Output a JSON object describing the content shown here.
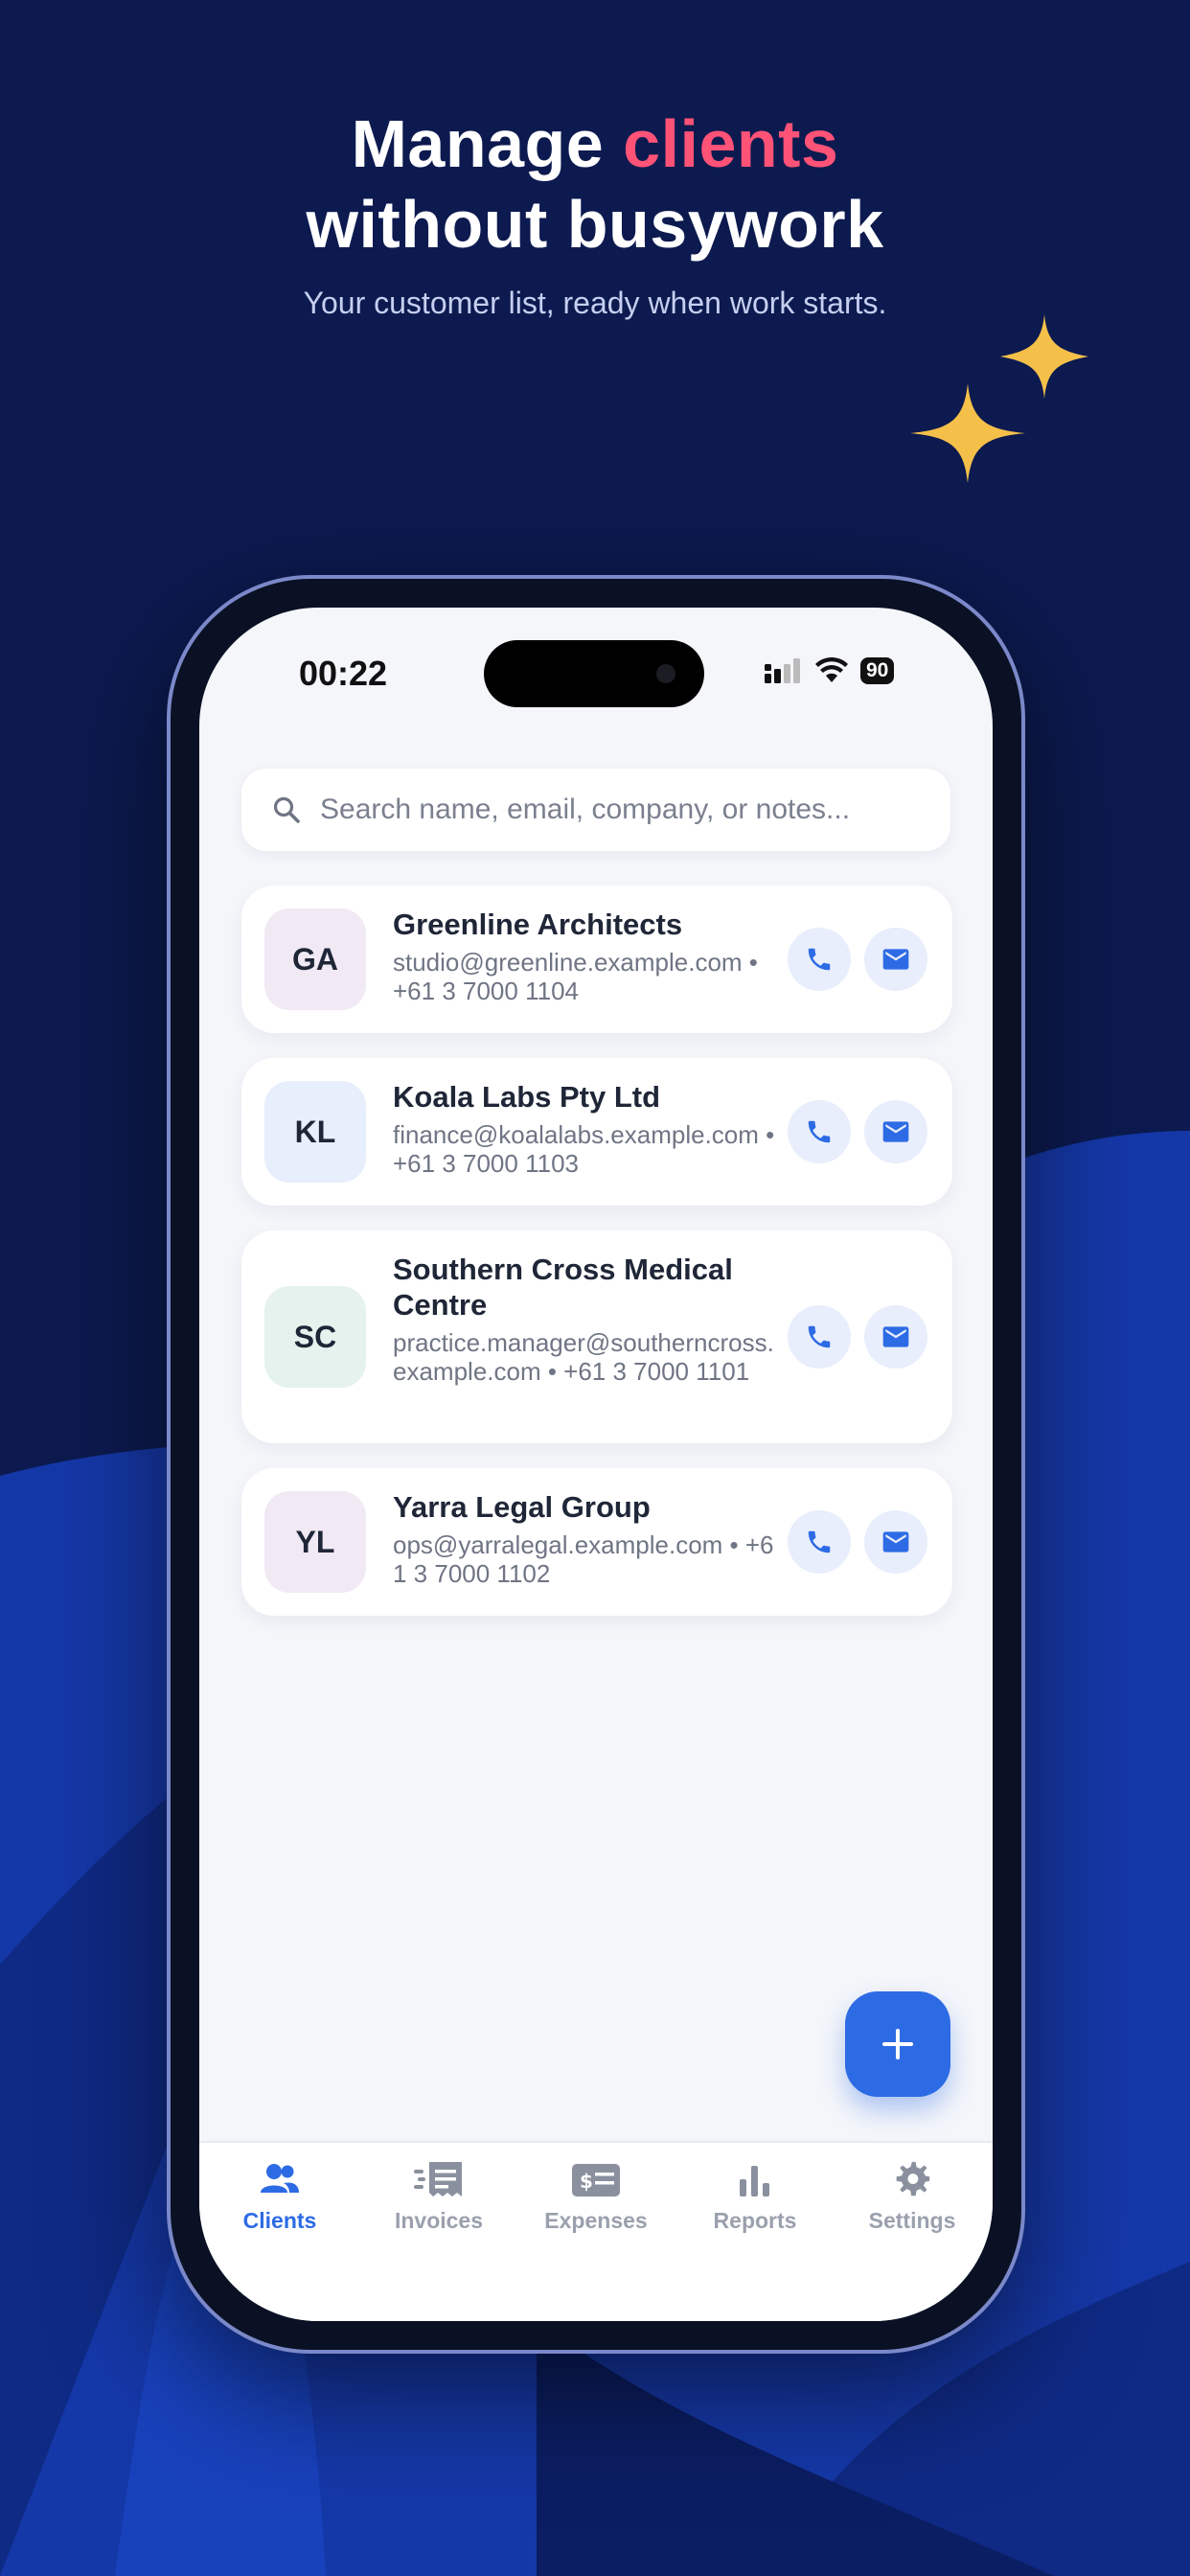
{
  "header": {
    "title_part1": "Manage ",
    "title_accent": "clients",
    "title_line2": "without busywork",
    "subtitle": "Your customer list, ready when work starts."
  },
  "status_bar": {
    "time": "00:22",
    "battery": "90"
  },
  "search": {
    "placeholder": "Search name, email, company, or notes..."
  },
  "clients": [
    {
      "initials": "GA",
      "name": "Greenline Architects",
      "contact": "studio@greenline.example.com • +61 3 7000 1104",
      "avatar_color": "#f1e9f4"
    },
    {
      "initials": "KL",
      "name": "Koala Labs Pty Ltd",
      "contact": "finance@koalalabs.example.com • +61 3 7000 1103",
      "avatar_color": "#e7eefc"
    },
    {
      "initials": "SC",
      "name": "Southern Cross Medical Centre",
      "contact": "practice.manager@southerncross.example.com • +61 3 7000 1101",
      "avatar_color": "#e5f2ee"
    },
    {
      "initials": "YL",
      "name": "Yarra Legal Group",
      "contact": "ops@yarralegal.example.com • +61 3 7000 1102",
      "avatar_color": "#f1e9f4"
    }
  ],
  "tabs": [
    {
      "label": "Clients",
      "icon": "people-icon",
      "active": true
    },
    {
      "label": "Invoices",
      "icon": "receipt-icon",
      "active": false
    },
    {
      "label": "Expenses",
      "icon": "money-icon",
      "active": false
    },
    {
      "label": "Reports",
      "icon": "bar-chart-icon",
      "active": false
    },
    {
      "label": "Settings",
      "icon": "gear-icon",
      "active": false
    }
  ],
  "colors": {
    "background": "#0c1a4f",
    "accent_pink": "#ff5277",
    "primary_blue": "#2d6be5",
    "sparkle": "#f5c04a"
  }
}
